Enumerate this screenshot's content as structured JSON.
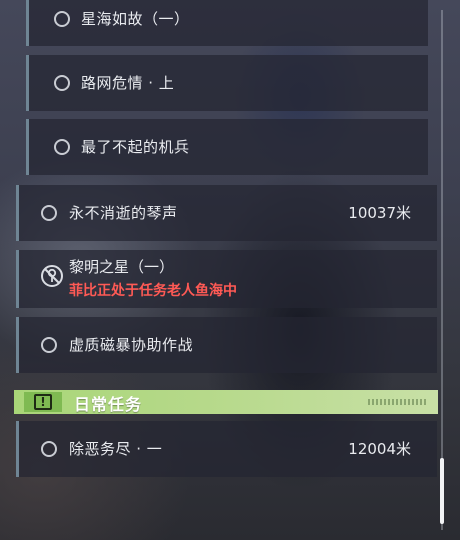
{
  "sub_quests": [
    {
      "label": "星海如故（一）"
    },
    {
      "label": "路网危情 · 上"
    },
    {
      "label": "最了不起的机兵"
    }
  ],
  "main_quests": [
    {
      "label": "永不消逝的琴声",
      "distance": "10037米"
    },
    {
      "label": "黎明之星（一）",
      "warning": "菲比正处于任务老人鱼海中",
      "icon": "blocked-icon"
    },
    {
      "label": "虚质磁暴协助作战"
    }
  ],
  "daily": {
    "header_title": "日常任务",
    "badge_icon": "!",
    "quests": [
      {
        "label": "除恶务尽 · 一",
        "distance": "12004米"
      }
    ]
  },
  "colors": {
    "accent_bar": "#6f8594",
    "daily_green": "#a9d678",
    "warning_red": "#ff5a55"
  }
}
